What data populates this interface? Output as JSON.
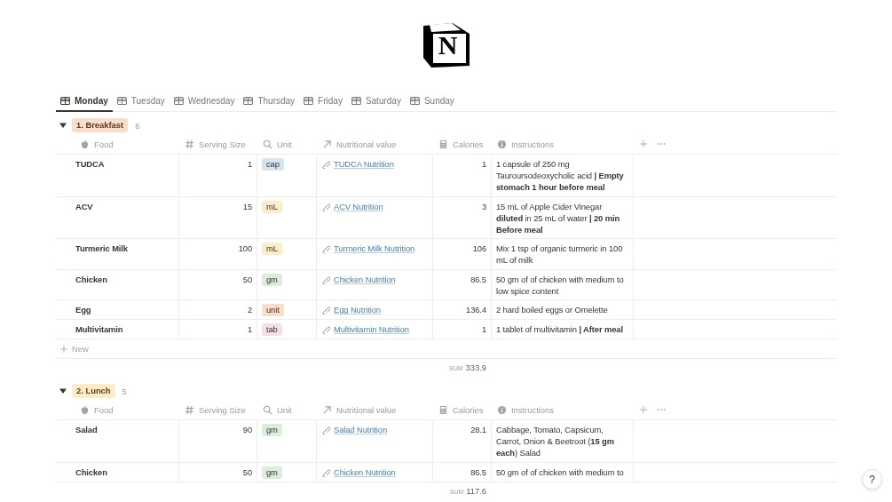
{
  "logo": {
    "letter": "N"
  },
  "tabs": [
    {
      "label": "Monday",
      "selected": true
    },
    {
      "label": "Tuesday",
      "selected": false
    },
    {
      "label": "Wednesday",
      "selected": false
    },
    {
      "label": "Thursday",
      "selected": false
    },
    {
      "label": "Friday",
      "selected": false
    },
    {
      "label": "Saturday",
      "selected": false
    },
    {
      "label": "Sunday",
      "selected": false
    }
  ],
  "groups": [
    {
      "label": "1. Breakfast",
      "color": "#fadec9",
      "count": "6",
      "expanded": true,
      "columns": [
        {
          "label": "Food",
          "kind": "title"
        },
        {
          "label": "Serving Size",
          "kind": "number"
        },
        {
          "label": "Unit",
          "kind": "rollup"
        },
        {
          "label": "Nutritional value",
          "kind": "relation"
        },
        {
          "label": "Calories",
          "kind": "formula"
        },
        {
          "label": "Instructions",
          "kind": "text"
        }
      ],
      "rows": [
        {
          "food": "TUDCA",
          "serving": "1",
          "unit": {
            "label": "cap",
            "color": "#d3e5ef"
          },
          "link": "TUDCA Nutrition",
          "calories": "1",
          "instructions": "1 capsule of 250 mg Tauroursodeoxycholic acid **| Empty stomach 1 hour before meal**"
        },
        {
          "food": "ACV",
          "serving": "15",
          "unit": {
            "label": "mL",
            "color": "#fdecc8"
          },
          "link": "ACV Nutrition",
          "calories": "3",
          "instructions": "15 mL of Apple Cider Vinegar **diluted** in 25 mL of water **| 20 min Before meal**"
        },
        {
          "food": "Turmeric Milk",
          "serving": "100",
          "unit": {
            "label": "mL",
            "color": "#fdecc8"
          },
          "link": "Turmeric Milk Nutrition",
          "calories": "106",
          "instructions": "Mix 1 tsp of organic turmeric in 100 mL of milk"
        },
        {
          "food": "Chicken",
          "serving": "50",
          "unit": {
            "label": "gm",
            "color": "#dbeddb"
          },
          "link": "Chicken Nutrition",
          "calories": "86.5",
          "instructions": "50 gm of of chicken with medium to low spice content"
        },
        {
          "food": "Egg",
          "serving": "2",
          "unit": {
            "label": "unit",
            "color": "#fadec9"
          },
          "link": "Egg Nutrition",
          "calories": "136.4",
          "instructions": "2 hard boiled eggs or Omelette"
        },
        {
          "food": "Multivitamin",
          "serving": "1",
          "unit": {
            "label": "tab",
            "color": "#f5e0e9"
          },
          "link": "Multivitamin Nutrition",
          "calories": "1",
          "instructions": "1 tablet of multivitamin **| After meal**"
        }
      ],
      "new_label": "New",
      "sum_label": "SUM",
      "sum": "333.9"
    },
    {
      "label": "2. Lunch",
      "color": "#fdecc8",
      "count": "5",
      "expanded": true,
      "columns": [
        {
          "label": "Food",
          "kind": "title"
        },
        {
          "label": "Serving Size",
          "kind": "number"
        },
        {
          "label": "Unit",
          "kind": "rollup"
        },
        {
          "label": "Nutritional value",
          "kind": "relation"
        },
        {
          "label": "Calories",
          "kind": "formula"
        },
        {
          "label": "Instructions",
          "kind": "text"
        }
      ],
      "rows": [
        {
          "food": "Salad",
          "serving": "90",
          "unit": {
            "label": "gm",
            "color": "#dbeddb"
          },
          "link": "Salad Nutrition",
          "calories": "28.1",
          "instructions": "Cabbage, Tomato, Capsicum, Carrot, Onion & Beetroot (**15 gm each**) Salad"
        },
        {
          "food": "Chicken",
          "serving": "50",
          "unit": {
            "label": "gm",
            "color": "#dbeddb"
          },
          "link": "Chicken Nutrition",
          "calories": "86.5",
          "instructions": "50 gm of of chicken with medium to"
        }
      ],
      "sum_label": "SUM",
      "sum": "117.6"
    }
  ],
  "help": "?"
}
